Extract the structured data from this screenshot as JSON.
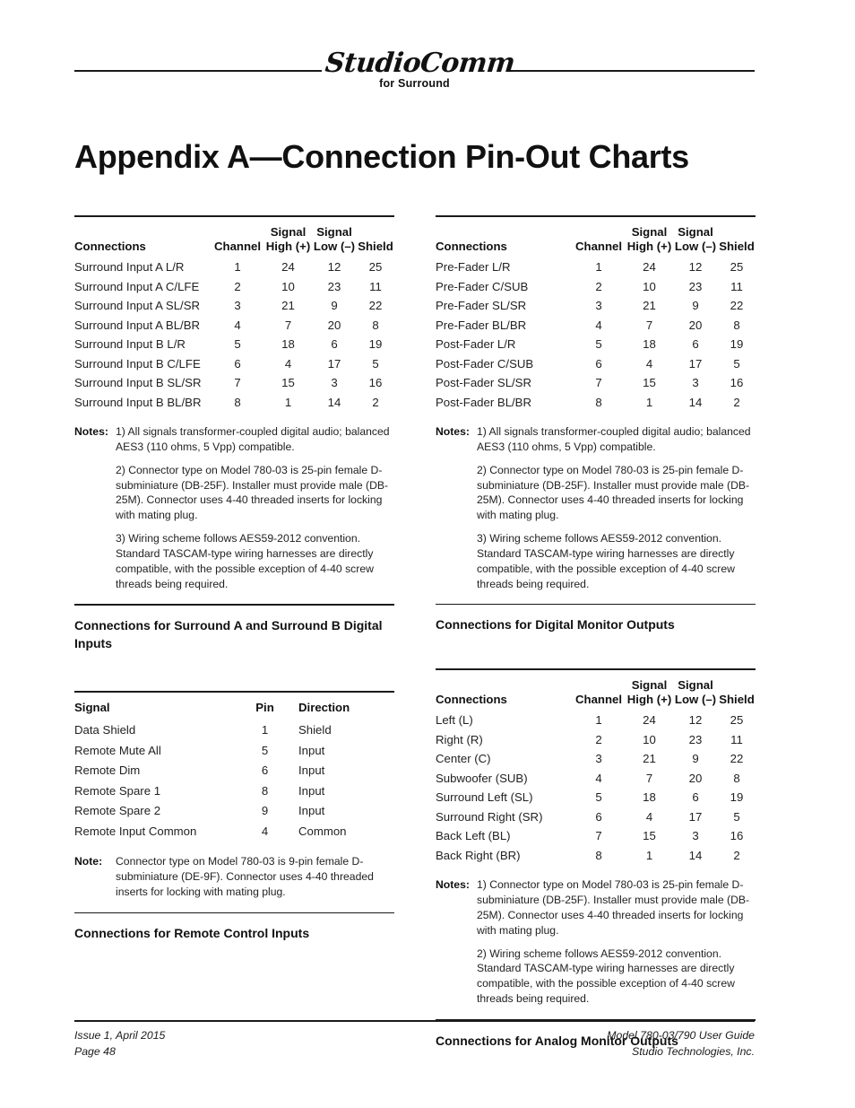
{
  "masthead": {
    "logo_script": "StudioComm",
    "logo_sub": "for Surround"
  },
  "title": "Appendix A—Connection Pin-Out Charts",
  "columns": {
    "left": {
      "table1": {
        "headers": {
          "connections": "Connections",
          "channel": "Channel",
          "signal_high_l1": "Signal",
          "signal_high_l2": "High (+)",
          "signal_low_l1": "Signal",
          "signal_low_l2": "Low (–)",
          "shield": "Shield"
        },
        "rows": [
          {
            "connection": "Surround Input A L/R",
            "channel": "1",
            "high": "24",
            "low": "12",
            "shield": "25"
          },
          {
            "connection": "Surround Input A C/LFE",
            "channel": "2",
            "high": "10",
            "low": "23",
            "shield": "11"
          },
          {
            "connection": "Surround Input A SL/SR",
            "channel": "3",
            "high": "21",
            "low": "9",
            "shield": "22"
          },
          {
            "connection": "Surround Input A BL/BR",
            "channel": "4",
            "high": "7",
            "low": "20",
            "shield": "8"
          },
          {
            "connection": "Surround Input B L/R",
            "channel": "5",
            "high": "18",
            "low": "6",
            "shield": "19"
          },
          {
            "connection": "Surround Input B C/LFE",
            "channel": "6",
            "high": "4",
            "low": "17",
            "shield": "5"
          },
          {
            "connection": "Surround Input B SL/SR",
            "channel": "7",
            "high": "15",
            "low": "3",
            "shield": "16"
          },
          {
            "connection": "Surround Input B BL/BR",
            "channel": "8",
            "high": "1",
            "low": "14",
            "shield": "2"
          }
        ]
      },
      "notes1": {
        "label": "Notes:",
        "paras": [
          "1) All signals transformer-coupled digital audio; balanced AES3 (110 ohms,  5 Vpp) compatible.",
          "2) Connector type on Model 780-03 is 25-pin female D-subminiature (DB-25F). Installer must provide male (DB-25M). Connector uses 4-40 threaded inserts for locking with mating plug.",
          "3) Wiring scheme follows AES59-2012 convention. Standard TASCAM-type wiring harnesses are directly compatible, with the possible exception of 4-40 screw threads being required."
        ]
      },
      "caption1": "Connections for Surround A and Surround B Digital Inputs",
      "table2": {
        "headers": {
          "signal": "Signal",
          "pin": "Pin",
          "direction": "Direction"
        },
        "rows": [
          {
            "signal": "Data Shield",
            "pin": "1",
            "direction": "Shield"
          },
          {
            "signal": "Remote Mute All",
            "pin": "5",
            "direction": "Input"
          },
          {
            "signal": "Remote Dim",
            "pin": "6",
            "direction": "Input"
          },
          {
            "signal": "Remote Spare 1",
            "pin": "8",
            "direction": "Input"
          },
          {
            "signal": "Remote Spare 2",
            "pin": "9",
            "direction": "Input"
          },
          {
            "signal": "Remote Input Common",
            "pin": "4",
            "direction": "Common"
          }
        ]
      },
      "notes2": {
        "label": "Note:",
        "paras": [
          "Connector type on Model 780-03 is 9-pin female D-subminiature (DE-9F). Connector uses 4-40 threaded inserts for locking with mating plug."
        ]
      },
      "caption2": "Connections for Remote Control Inputs"
    },
    "right": {
      "table1": {
        "headers": {
          "connections": "Connections",
          "channel": "Channel",
          "signal_high_l1": "Signal",
          "signal_high_l2": "High (+)",
          "signal_low_l1": "Signal",
          "signal_low_l2": "Low (–)",
          "shield": "Shield"
        },
        "rows": [
          {
            "connection": "Pre-Fader L/R",
            "channel": "1",
            "high": "24",
            "low": "12",
            "shield": "25"
          },
          {
            "connection": "Pre-Fader C/SUB",
            "channel": "2",
            "high": "10",
            "low": "23",
            "shield": "11"
          },
          {
            "connection": "Pre-Fader SL/SR",
            "channel": "3",
            "high": "21",
            "low": "9",
            "shield": "22"
          },
          {
            "connection": "Pre-Fader BL/BR",
            "channel": "4",
            "high": "7",
            "low": "20",
            "shield": "8"
          },
          {
            "connection": "Post-Fader L/R",
            "channel": "5",
            "high": "18",
            "low": "6",
            "shield": "19"
          },
          {
            "connection": "Post-Fader C/SUB",
            "channel": "6",
            "high": "4",
            "low": "17",
            "shield": "5"
          },
          {
            "connection": "Post-Fader SL/SR",
            "channel": "7",
            "high": "15",
            "low": "3",
            "shield": "16"
          },
          {
            "connection": "Post-Fader BL/BR",
            "channel": "8",
            "high": "1",
            "low": "14",
            "shield": "2"
          }
        ]
      },
      "notes1": {
        "label": "Notes:",
        "paras": [
          "1) All signals transformer-coupled digital audio; balanced AES3 (110 ohms,  5 Vpp) compatible.",
          "2) Connector type on Model 780-03 is 25-pin female D-subminiature (DB-25F). Installer must provide male (DB-25M). Connector uses 4-40 threaded inserts for locking with mating plug.",
          "3) Wiring scheme follows AES59-2012 convention. Standard TASCAM-type wiring harnesses are directly compatible, with the possible exception of 4-40 screw threads being required."
        ]
      },
      "caption1": "Connections for Digital Monitor Outputs",
      "table2": {
        "headers": {
          "connections": "Connections",
          "channel": "Channel",
          "signal_high_l1": "Signal",
          "signal_high_l2": "High (+)",
          "signal_low_l1": "Signal",
          "signal_low_l2": "Low (–)",
          "shield": "Shield"
        },
        "rows": [
          {
            "connection": "Left (L)",
            "channel": "1",
            "high": "24",
            "low": "12",
            "shield": "25"
          },
          {
            "connection": "Right (R)",
            "channel": "2",
            "high": "10",
            "low": "23",
            "shield": "11"
          },
          {
            "connection": "Center (C)",
            "channel": "3",
            "high": "21",
            "low": "9",
            "shield": "22"
          },
          {
            "connection": "Subwoofer (SUB)",
            "channel": "4",
            "high": "7",
            "low": "20",
            "shield": "8"
          },
          {
            "connection": "Surround Left (SL)",
            "channel": "5",
            "high": "18",
            "low": "6",
            "shield": "19"
          },
          {
            "connection": "Surround Right (SR)",
            "channel": "6",
            "high": "4",
            "low": "17",
            "shield": "5"
          },
          {
            "connection": "Back Left (BL)",
            "channel": "7",
            "high": "15",
            "low": "3",
            "shield": "16"
          },
          {
            "connection": "Back Right (BR)",
            "channel": "8",
            "high": "1",
            "low": "14",
            "shield": "2"
          }
        ]
      },
      "notes2": {
        "label": "Notes:",
        "paras": [
          "1) Connector type on Model 780-03 is 25-pin female D-subminiature (DB-25F). Installer must provide male (DB-25M). Connector uses 4-40 threaded inserts for locking with mating plug.",
          "2) Wiring scheme follows AES59-2012 convention. Standard TASCAM-type wiring harnesses are directly compatible, with the possible exception of 4-40 screw threads being required."
        ]
      },
      "caption2": "Connections for Analog Monitor Outputs"
    }
  },
  "footer": {
    "left_line1": "Issue 1, April 2015",
    "left_line2": "Page 48",
    "right_line1": "Model 780-03/790 User Guide",
    "right_line2": "Studio Technologies, Inc."
  }
}
